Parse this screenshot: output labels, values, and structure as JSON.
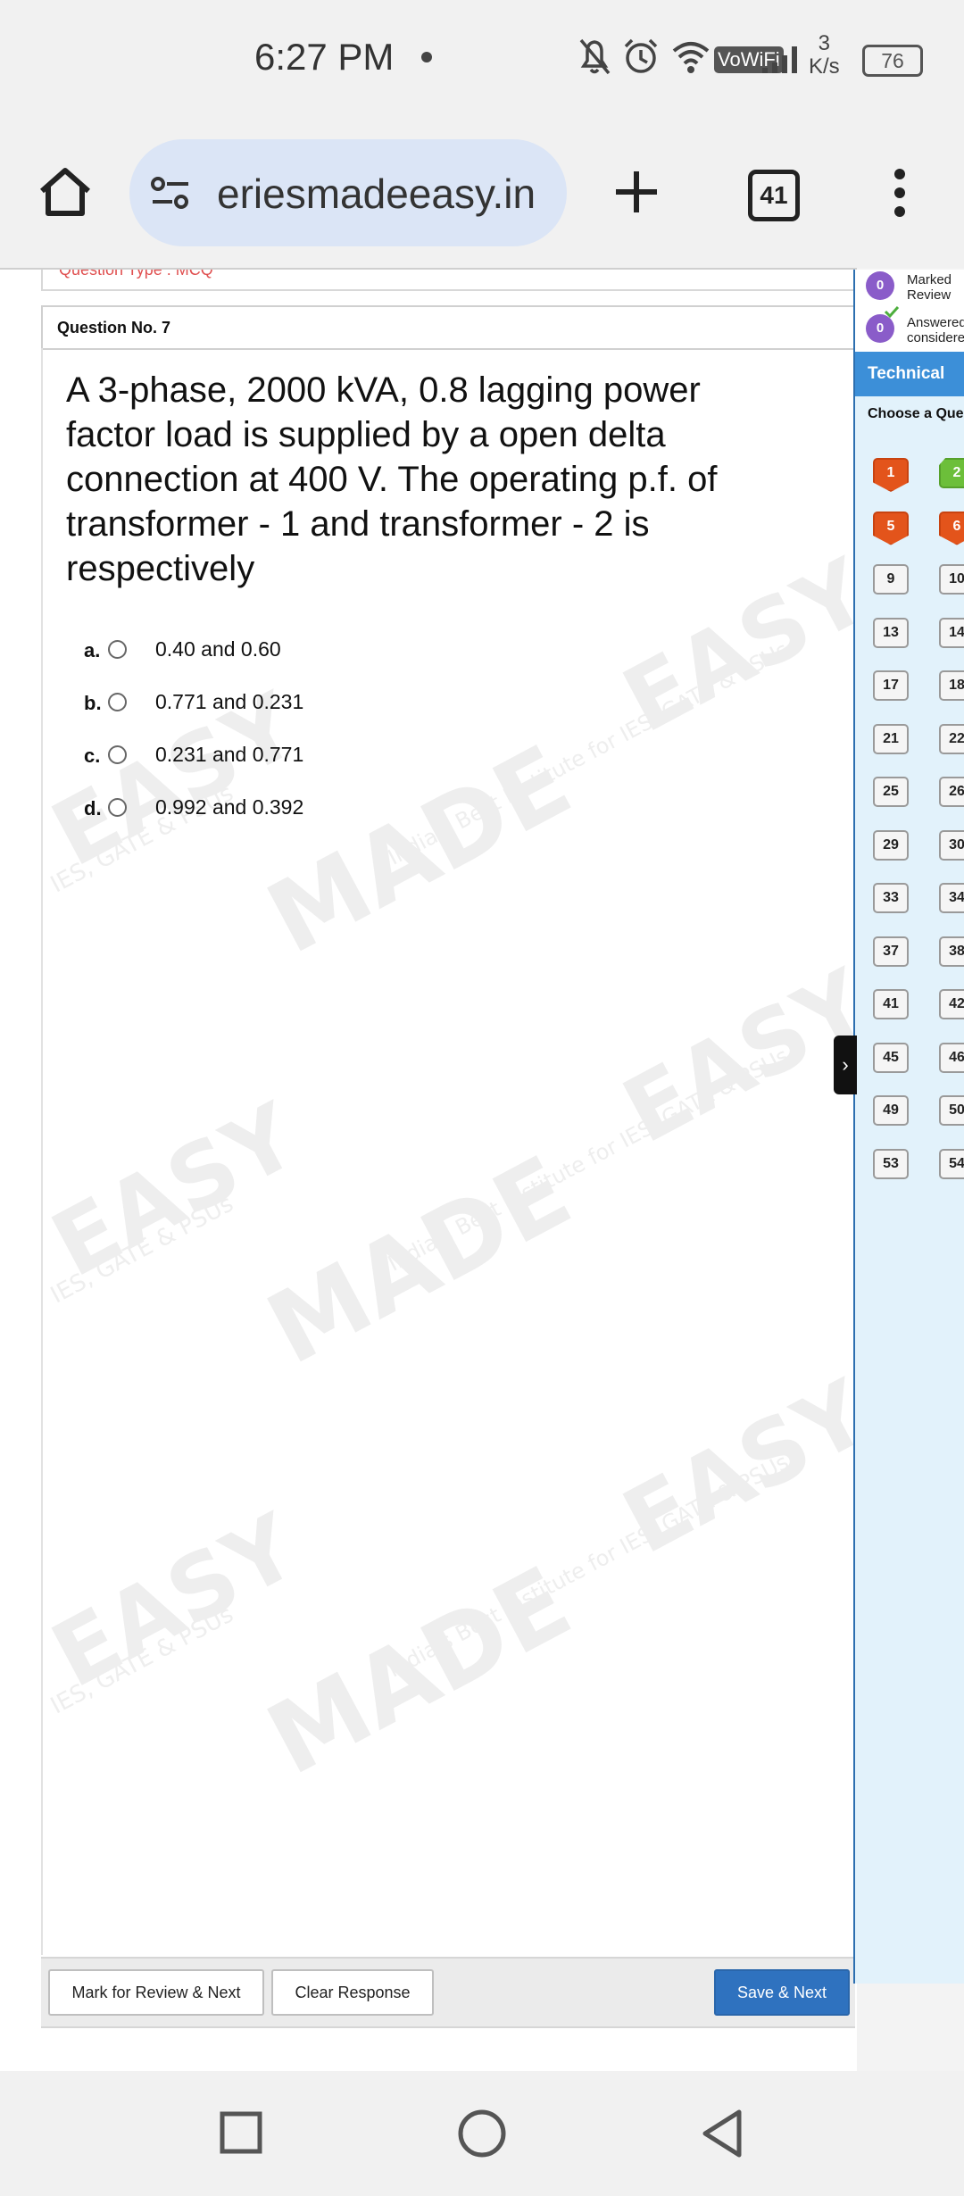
{
  "status_bar": {
    "time": "6:27 PM",
    "network_label": "VoWiFi",
    "speed_value": "3",
    "speed_unit": "K/s",
    "battery": "76",
    "icons": [
      "mute-bell-icon",
      "alarm-icon",
      "wifi-icon",
      "signal-icon"
    ]
  },
  "browser": {
    "url": "eriesmadeeasy.in",
    "tab_count": "41",
    "icons": [
      "home-icon",
      "site-settings-icon",
      "new-tab-plus-icon",
      "tab-switcher-icon",
      "more-vert-icon"
    ]
  },
  "exam": {
    "prev_panel_text": "Question Type : MCQ",
    "question_number_label": "Question No. 7",
    "question_text": "A 3-phase, 2000 kVA, 0.8 lagging power factor load is supplied by a open delta connection at 400 V. The operating p.f. of transformer - 1 and transformer - 2 is respectively",
    "options": [
      {
        "letter": "a.",
        "text": "0.40 and 0.60"
      },
      {
        "letter": "b.",
        "text": "0.771 and 0.231"
      },
      {
        "letter": "c.",
        "text": "0.231 and 0.771"
      },
      {
        "letter": "d.",
        "text": "0.992 and 0.392"
      }
    ],
    "buttons": {
      "mark_review": "Mark for Review & Next",
      "clear": "Clear Response",
      "save_next": "Save & Next"
    }
  },
  "watermark": {
    "brand": "MADE EASY",
    "brand_short": "MADE",
    "brand_tail": "EASY",
    "tagline": "India's Best Institute for IES, GATE & PSUs",
    "tagline_short": "IES, GATE & PSUs"
  },
  "side_panel": {
    "legend": [
      {
        "count": "0",
        "label_line1": "Marked",
        "label_line2": "Review"
      },
      {
        "count": "0",
        "label_line1": "Answered",
        "label_line2": "considere"
      }
    ],
    "section_tab": "Technical",
    "choose_label": "Choose a Ques",
    "question_buttons": [
      {
        "num": "1",
        "state": "not-answered"
      },
      {
        "num": "2",
        "state": "answered"
      },
      {
        "num": "5",
        "state": "not-answered"
      },
      {
        "num": "6",
        "state": "not-answered"
      },
      {
        "num": "9",
        "state": "not-visited"
      },
      {
        "num": "10",
        "state": "not-visited"
      },
      {
        "num": "13",
        "state": "not-visited"
      },
      {
        "num": "14",
        "state": "not-visited"
      },
      {
        "num": "17",
        "state": "not-visited"
      },
      {
        "num": "18",
        "state": "not-visited"
      },
      {
        "num": "21",
        "state": "not-visited"
      },
      {
        "num": "22",
        "state": "not-visited"
      },
      {
        "num": "25",
        "state": "not-visited"
      },
      {
        "num": "26",
        "state": "not-visited"
      },
      {
        "num": "29",
        "state": "not-visited"
      },
      {
        "num": "30",
        "state": "not-visited"
      },
      {
        "num": "33",
        "state": "not-visited"
      },
      {
        "num": "34",
        "state": "not-visited"
      },
      {
        "num": "37",
        "state": "not-visited"
      },
      {
        "num": "38",
        "state": "not-visited"
      },
      {
        "num": "41",
        "state": "not-visited"
      },
      {
        "num": "42",
        "state": "not-visited"
      },
      {
        "num": "45",
        "state": "not-visited"
      },
      {
        "num": "46",
        "state": "not-visited"
      },
      {
        "num": "49",
        "state": "not-visited"
      },
      {
        "num": "50",
        "state": "not-visited"
      },
      {
        "num": "53",
        "state": "not-visited"
      },
      {
        "num": "54",
        "state": "not-visited"
      }
    ],
    "colors": {
      "not_answered": "#e3541b",
      "answered": "#6cbf3a",
      "marked": "#8a5cc9",
      "section": "#3c8fd8"
    }
  },
  "nav_bar": {
    "icons": [
      "recents-square-icon",
      "home-circle-icon",
      "back-triangle-icon"
    ]
  }
}
